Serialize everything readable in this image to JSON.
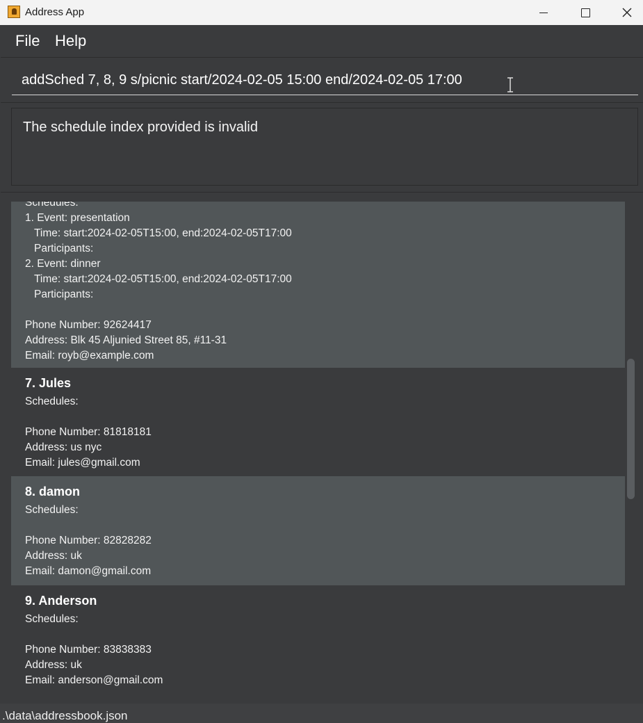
{
  "window": {
    "title": "Address App"
  },
  "menu": {
    "file": "File",
    "help": "Help"
  },
  "command": {
    "value": "addSched 7, 8, 9 s/picnic start/2024-02-05 15:00 end/2024-02-05 17:00"
  },
  "result": {
    "message": "The schedule index provided is invalid"
  },
  "persons": [
    {
      "index": "",
      "name": "",
      "schedules_label": "Schedules:",
      "schedules": [
        {
          "event": "1. Event: presentation",
          "time": "Time: start:2024-02-05T15:00, end:2024-02-05T17:00",
          "participants": "Participants:"
        },
        {
          "event": "2. Event: dinner",
          "time": "Time: start:2024-02-05T15:00, end:2024-02-05T17:00",
          "participants": "Participants:"
        }
      ],
      "phone": "Phone Number: 92624417",
      "address": "Address: Blk 45 Aljunied Street 85, #11-31",
      "email": "Email: royb@example.com"
    },
    {
      "name": "7.  Jules",
      "schedules_label": "Schedules:",
      "phone": "Phone Number: 81818181",
      "address": "Address: us nyc",
      "email": "Email: jules@gmail.com"
    },
    {
      "name": "8.  damon",
      "schedules_label": "Schedules:",
      "phone": "Phone Number: 82828282",
      "address": "Address: uk",
      "email": "Email: damon@gmail.com"
    },
    {
      "name": "9.  Anderson",
      "schedules_label": "Schedules:",
      "phone": "Phone Number: 83838383",
      "address": "Address: uk",
      "email": "Email: anderson@gmail.com"
    }
  ],
  "status": {
    "path": ".\\data\\addressbook.json"
  },
  "icons": {
    "app": "address-book-icon",
    "minimize": "minimize-icon",
    "maximize": "maximize-icon",
    "close": "close-icon",
    "text_cursor": "text-cursor-icon"
  },
  "colors": {
    "background": "#3a3b3d",
    "card_alt": "#515658",
    "titlebar": "#f3f3f3"
  }
}
